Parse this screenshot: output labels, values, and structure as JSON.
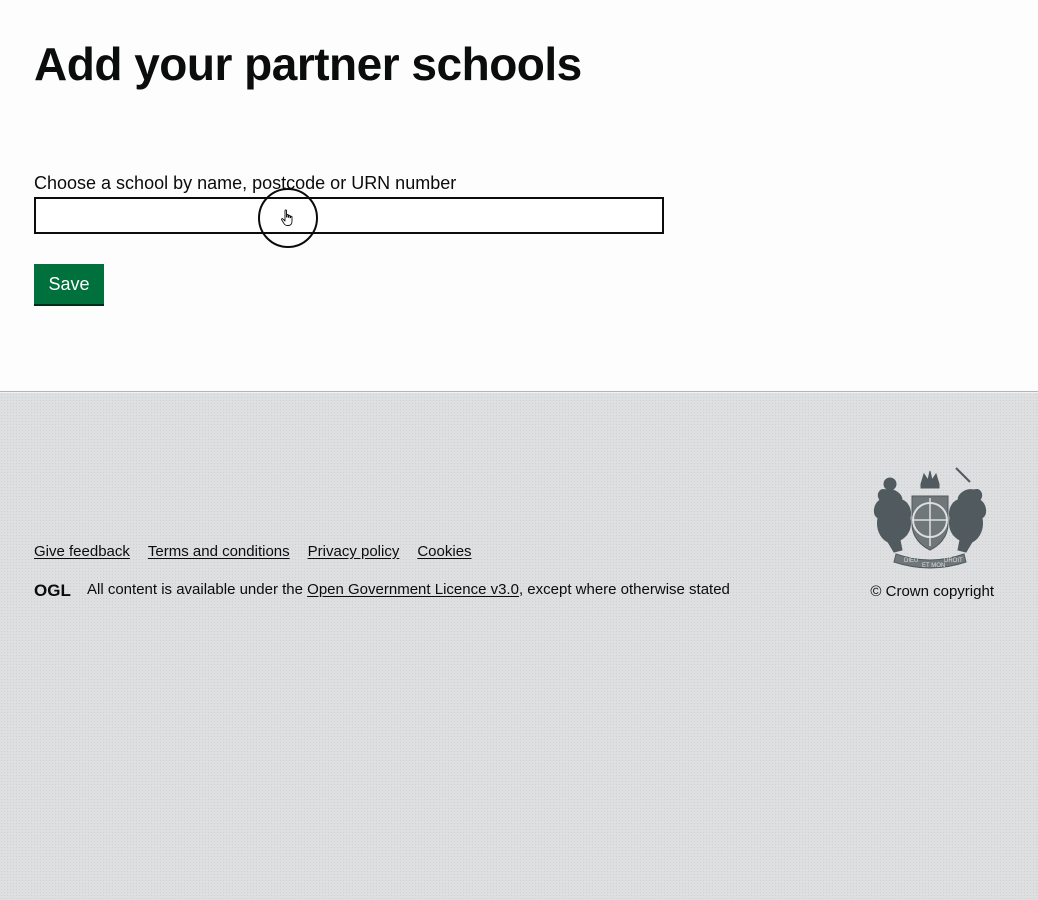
{
  "main": {
    "title": "Add your partner schools",
    "field_label": "Choose a school by name, postcode or URN number",
    "search_value": "",
    "save_label": "Save"
  },
  "footer": {
    "links": [
      "Give feedback",
      "Terms and conditions",
      "Privacy policy",
      "Cookies"
    ],
    "licence_prefix": "All content is available under the ",
    "licence_link": "Open Government Licence v3.0",
    "licence_suffix": ", except where otherwise stated",
    "copyright": "© Crown copyright",
    "ogl_logo_text": "OGL",
    "crest_motto_1": "DIEU",
    "crest_motto_2": "ET MON",
    "crest_motto_3": "DROIT"
  },
  "icons": {
    "cursor": "hand-pointer-icon",
    "crest": "royal-coat-of-arms-icon",
    "ogl": "ogl-logo-icon"
  },
  "colors": {
    "button_green": "#00703c",
    "footer_bg": "#dedfe0",
    "text": "#0b0c0c"
  }
}
